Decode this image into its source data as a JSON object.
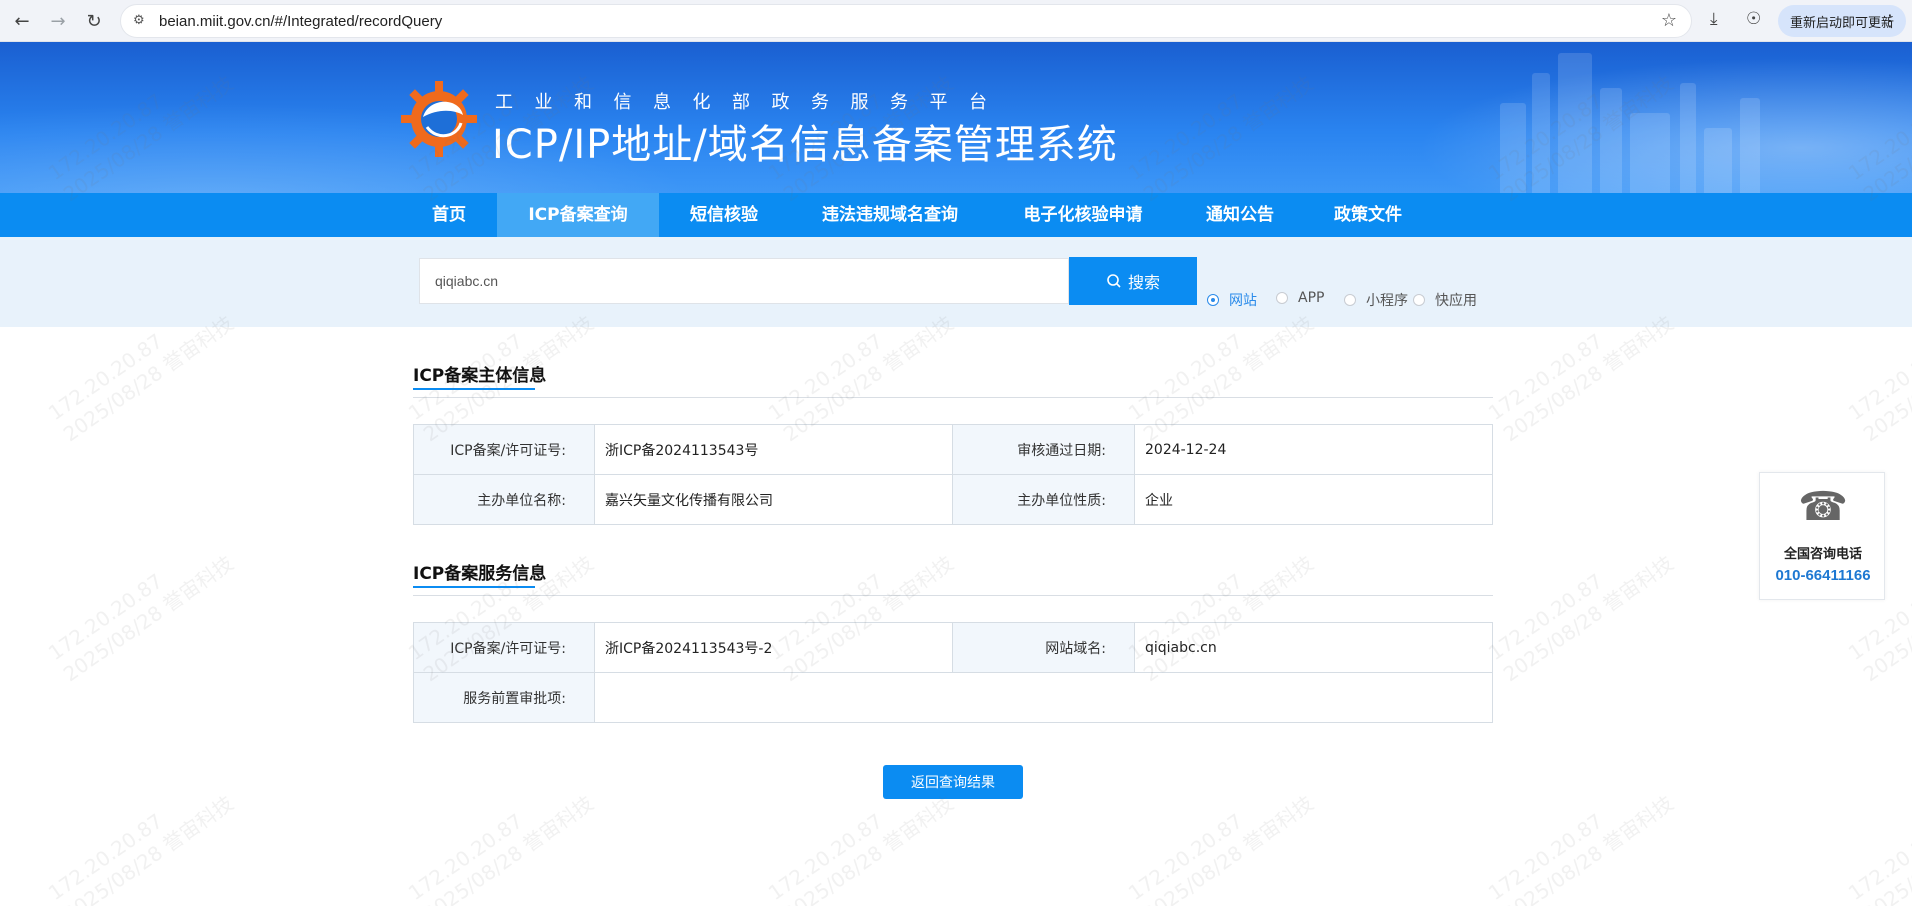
{
  "browser": {
    "url": "beian.miit.gov.cn/#/Integrated/recordQuery",
    "update_label": "重新启动即可更新"
  },
  "banner": {
    "subtitle": "工业和信息化部政务服务平台",
    "title": "ICP/IP地址/域名信息备案管理系统"
  },
  "nav": {
    "items": [
      {
        "label": "首页"
      },
      {
        "label": "ICP备案查询"
      },
      {
        "label": "短信核验"
      },
      {
        "label": "违法违规域名查询"
      },
      {
        "label": "电子化核验申请"
      },
      {
        "label": "通知公告"
      },
      {
        "label": "政策文件"
      }
    ],
    "active_index": 1
  },
  "search": {
    "value": "qiqiabc.cn",
    "button_label": "搜索",
    "types": [
      {
        "label": "网站",
        "checked": true
      },
      {
        "label": "APP",
        "checked": false
      },
      {
        "label": "小程序",
        "checked": false
      },
      {
        "label": "快应用",
        "checked": false
      }
    ]
  },
  "subject": {
    "title": "ICP备案主体信息",
    "rows": [
      {
        "label1": "ICP备案/许可证号:",
        "value1": "浙ICP备2024113543号",
        "label2": "审核通过日期:",
        "value2": "2024-12-24"
      },
      {
        "label1": "主办单位名称:",
        "value1": "嘉兴矢量文化传播有限公司",
        "label2": "主办单位性质:",
        "value2": "企业"
      }
    ]
  },
  "service": {
    "title": "ICP备案服务信息",
    "license_label": "ICP备案/许可证号:",
    "license_value": "浙ICP备2024113543号-2",
    "domain_label": "网站域名:",
    "domain_value": "qiqiabc.cn",
    "approval_label": "服务前置审批项:",
    "approval_value": ""
  },
  "back_button_label": "返回查询结果",
  "hotline": {
    "label": "全国咨询电话",
    "number": "010-66411166"
  },
  "watermark": {
    "line1": "172.20.20.87",
    "line2": "2025/08/28 誉宙科技"
  },
  "colors": {
    "brand_blue": "#0b8cf2",
    "banner_dark": "#1a5fd1",
    "active_nav": "#42a8f5",
    "hotline_blue": "#1e78d2"
  }
}
